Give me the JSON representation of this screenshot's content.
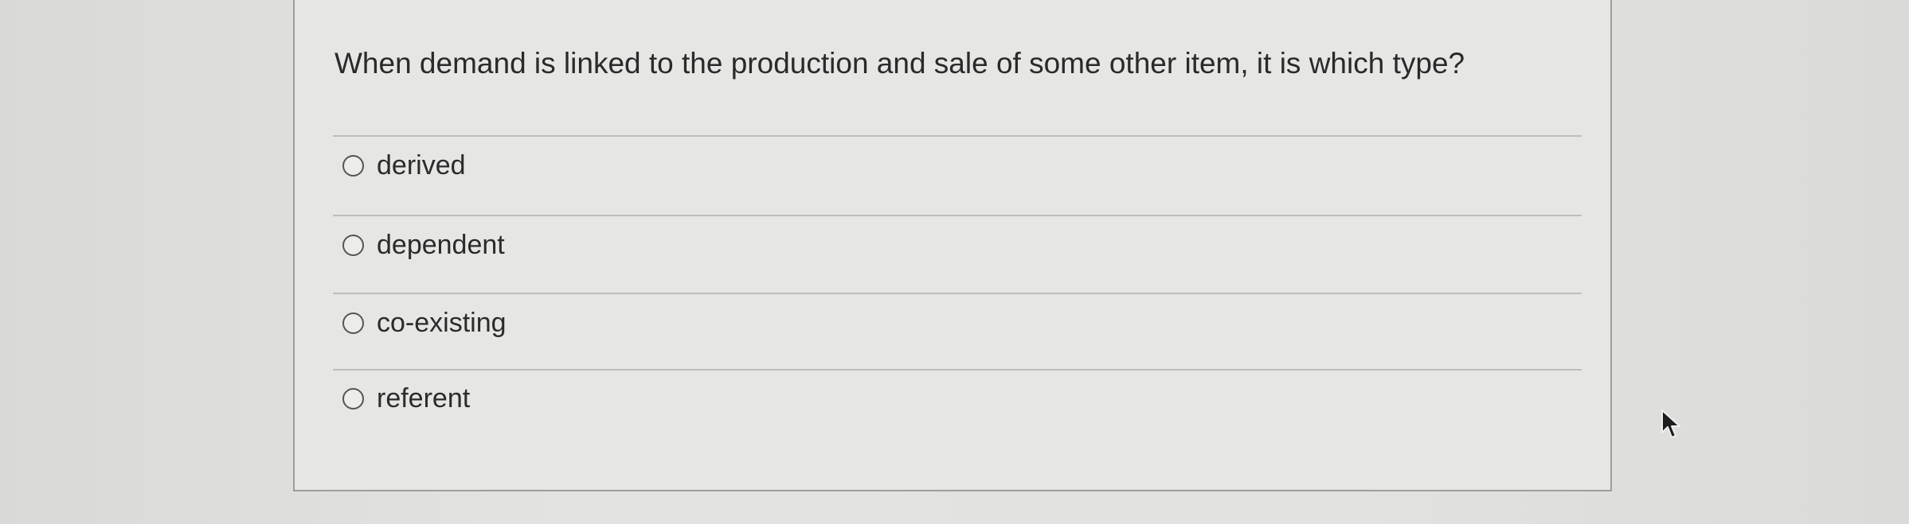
{
  "question": {
    "text": "When demand is linked to the production and sale of some other item, it is which type?"
  },
  "options": [
    {
      "label": "derived",
      "selected": false
    },
    {
      "label": "dependent",
      "selected": false
    },
    {
      "label": "co-existing",
      "selected": false
    },
    {
      "label": "referent",
      "selected": false
    }
  ],
  "icons": {
    "radio": "radio-circle-icon",
    "cursor": "mouse-pointer-icon"
  },
  "colors": {
    "card_background": "#e6e6e4",
    "page_background": "#dededc",
    "text": "#2b2b2b"
  }
}
